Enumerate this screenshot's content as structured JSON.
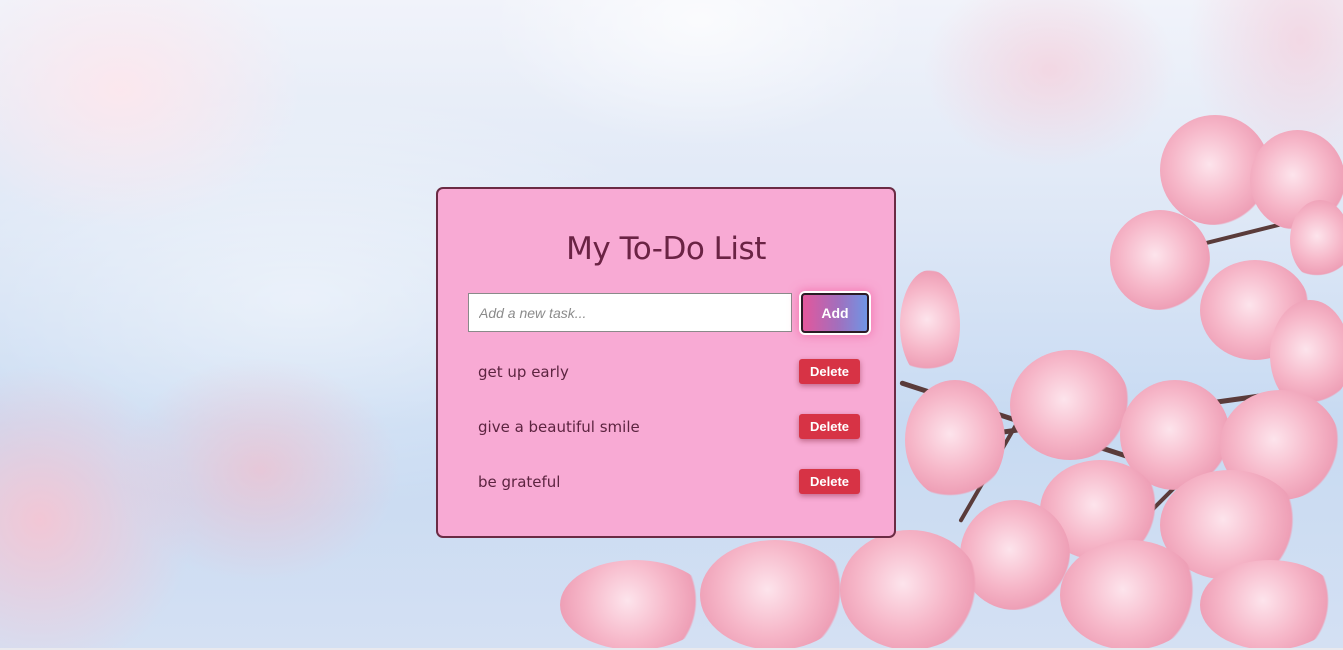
{
  "app": {
    "title": "My To-Do List"
  },
  "input": {
    "value": "",
    "placeholder": "Add a new task..."
  },
  "add_button": {
    "label": "Add"
  },
  "tasks": [
    {
      "text": "get up early",
      "delete_label": "Delete"
    },
    {
      "text": "give a beautiful smile",
      "delete_label": "Delete"
    },
    {
      "text": "be grateful",
      "delete_label": "Delete"
    }
  ],
  "colors": {
    "card_background": "#f8aad4",
    "card_border": "#6b2b44",
    "title_text": "#6a2344",
    "delete_button": "#d73345",
    "add_button_gradient_start": "#e3579c",
    "add_button_gradient_end": "#6f95e5"
  }
}
